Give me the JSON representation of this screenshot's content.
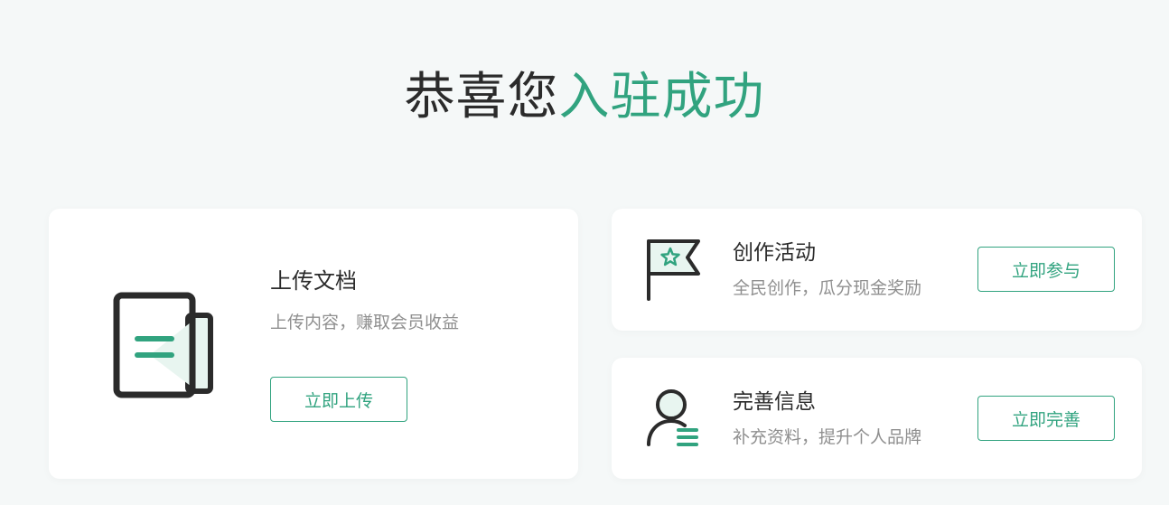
{
  "header": {
    "title_part1": "恭喜您",
    "title_part2": "入驻成功"
  },
  "colors": {
    "accent": "#31a37f",
    "text_dark": "#2b2b2b",
    "text_muted": "#8f8f8f",
    "background": "#f5f8f8"
  },
  "upload_card": {
    "icon": "document-upload-icon",
    "title": "上传文档",
    "subtitle": "上传内容，赚取会员收益",
    "button": "立即上传"
  },
  "activity_card": {
    "icon": "flag-star-icon",
    "title": "创作活动",
    "subtitle": "全民创作，瓜分现金奖励",
    "button": "立即参与"
  },
  "profile_card": {
    "icon": "user-profile-icon",
    "title": "完善信息",
    "subtitle": "补充资料，提升个人品牌",
    "button": "立即完善"
  }
}
